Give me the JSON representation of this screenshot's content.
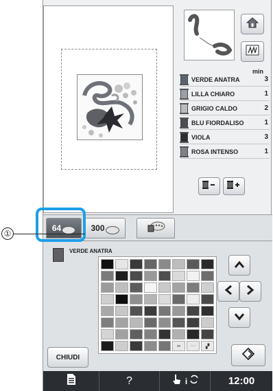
{
  "callout": {
    "number": "①"
  },
  "preview": {},
  "colors": {
    "min_header": "min",
    "items": [
      {
        "name": "VERDE ANATRA",
        "min": "3",
        "color": "#5c6470"
      },
      {
        "name": "LILLA CHIARO",
        "min": "1",
        "color": "#9aa0a6"
      },
      {
        "name": "GRIGIO CALDO",
        "min": "2",
        "color": "#b9bcbf"
      },
      {
        "name": "BLU FIORDALISO",
        "min": "1",
        "color": "#4a4d52"
      },
      {
        "name": "VIOLA",
        "min": "3",
        "color": "#2c2e32"
      },
      {
        "name": "ROSA INTENSO",
        "min": "1",
        "color": "#7d8289"
      }
    ]
  },
  "tabs": {
    "t64": "64",
    "t300": "300"
  },
  "palette": {
    "selected_name": "VERDE ANATRA",
    "selected_color": "#5e6065",
    "close_label": "CHIUDI",
    "cells": [
      "#111111",
      "#e6e6e6",
      "#3a3a3a",
      "#666666",
      "#8a8a8a",
      "#bdbdbd",
      "#5a5a5a",
      "#2a2a2a",
      "#7a7a7a",
      "#1e1e1e",
      "#4b4b4b",
      "#999999",
      "#4e4e4e",
      "#dadada",
      "#f2f2f2",
      "#6d6d6d",
      "#9b9b9b",
      "#bebebe",
      "#5c5c5c",
      "#f5f5f5",
      "#c9c9c9",
      "#a3a3a3",
      "#7c7c7c",
      "#d0d0d0",
      "#cfcfcf",
      "#0f0f0f",
      "#8f8f8f",
      "#b5b5b5",
      "#dcdcdc",
      "#6a6a6a",
      "#ededed",
      "#4a4a4a",
      "#a8a8a8",
      "#c7c7c7",
      "#525252",
      "#3c3c3c",
      "#777777",
      "#999999",
      "#444444",
      "#2f2f2f",
      "#7e7e7e",
      "#a4a4a4",
      "#b9b9b9",
      "#6b6b6b",
      "#8e8e8e",
      "#565656",
      "#3e3e3e",
      "#cccccc",
      "#d4d4d4",
      "#a1a1a1",
      "#5f5f5f",
      "#818181",
      "#333333",
      "#b0b0b0",
      "#272727",
      "#444444",
      "#1b1b1b",
      "#cdcdcd",
      "#3a3a3a",
      "#8c8c8c",
      "#767676",
      "#d8d8d8",
      "#e2e2e2",
      "#cfcfcf"
    ]
  },
  "statusbar": {
    "help": "?",
    "time": "12:00"
  }
}
